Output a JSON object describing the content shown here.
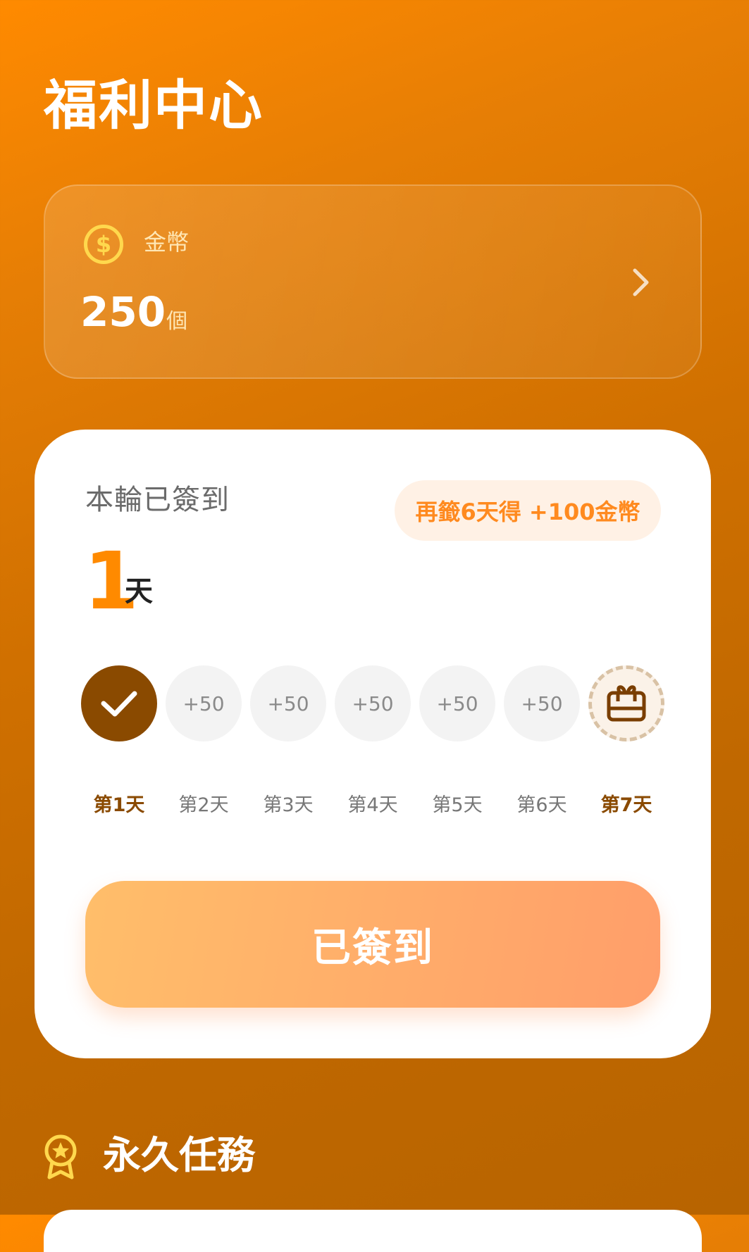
{
  "page": {
    "title": "福利中心"
  },
  "coin_card": {
    "label": "金幣",
    "amount": "250",
    "unit": "個",
    "icon": "dollar-coin-icon",
    "chevron": "chevron-right-icon"
  },
  "signin": {
    "heading": "本輪已簽到",
    "bonus_pill": "再籤6天得 +100金幣",
    "day_count": "1",
    "day_count_unit": "天",
    "days": [
      {
        "reward": "",
        "label": "第1天",
        "state": "done",
        "icon": "check-icon"
      },
      {
        "reward": "+50",
        "label": "第2天",
        "state": "pending"
      },
      {
        "reward": "+50",
        "label": "第3天",
        "state": "pending"
      },
      {
        "reward": "+50",
        "label": "第4天",
        "state": "pending"
      },
      {
        "reward": "+50",
        "label": "第5天",
        "state": "pending"
      },
      {
        "reward": "+50",
        "label": "第6天",
        "state": "pending"
      },
      {
        "reward": "",
        "label": "第7天",
        "state": "gift",
        "icon": "gift-box-icon"
      }
    ],
    "button_label": "已簽到"
  },
  "tasks": {
    "title": "永久任務",
    "icon": "medal-icon"
  },
  "colors": {
    "accent": "#FF8A00",
    "done_circle": "#8A4A00",
    "coin_yellow": "#FFD84D",
    "pill_text": "#FF8A1F"
  }
}
